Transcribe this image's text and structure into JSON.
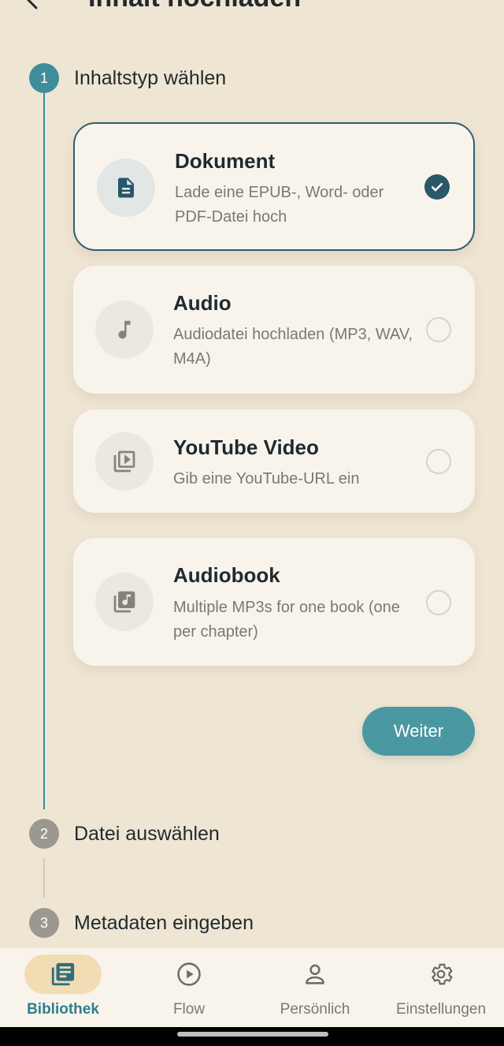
{
  "header": {
    "title": "Inhalt hochladen"
  },
  "steps": [
    {
      "number": "1",
      "label": "Inhaltstyp wählen"
    },
    {
      "number": "2",
      "label": "Datei auswählen"
    },
    {
      "number": "3",
      "label": "Metadaten eingeben"
    }
  ],
  "options": [
    {
      "title": "Dokument",
      "description": "Lade eine EPUB-, Word- oder PDF-Datei hoch",
      "icon": "document-icon",
      "selected": true
    },
    {
      "title": "Audio",
      "description": "Audiodatei hochladen (MP3, WAV, M4A)",
      "icon": "music-note-icon",
      "selected": false
    },
    {
      "title": "YouTube Video",
      "description": "Gib eine YouTube-URL ein",
      "icon": "video-library-icon",
      "selected": false
    },
    {
      "title": "Audiobook",
      "description": "Multiple MP3s for one book (one per chapter)",
      "icon": "audiobook-library-icon",
      "selected": false
    }
  ],
  "next_button": {
    "label": "Weiter"
  },
  "bottom_nav": [
    {
      "label": "Bibliothek",
      "icon": "library-icon",
      "active": true
    },
    {
      "label": "Flow",
      "icon": "play-circle-icon",
      "active": false
    },
    {
      "label": "Persönlich",
      "icon": "person-icon",
      "active": false
    },
    {
      "label": "Einstellungen",
      "icon": "gear-icon",
      "active": false
    }
  ],
  "colors": {
    "accent": "#3d8e98",
    "selected_border": "#2f5f6d",
    "background": "#efe5d3",
    "card": "#f8f4ec"
  }
}
